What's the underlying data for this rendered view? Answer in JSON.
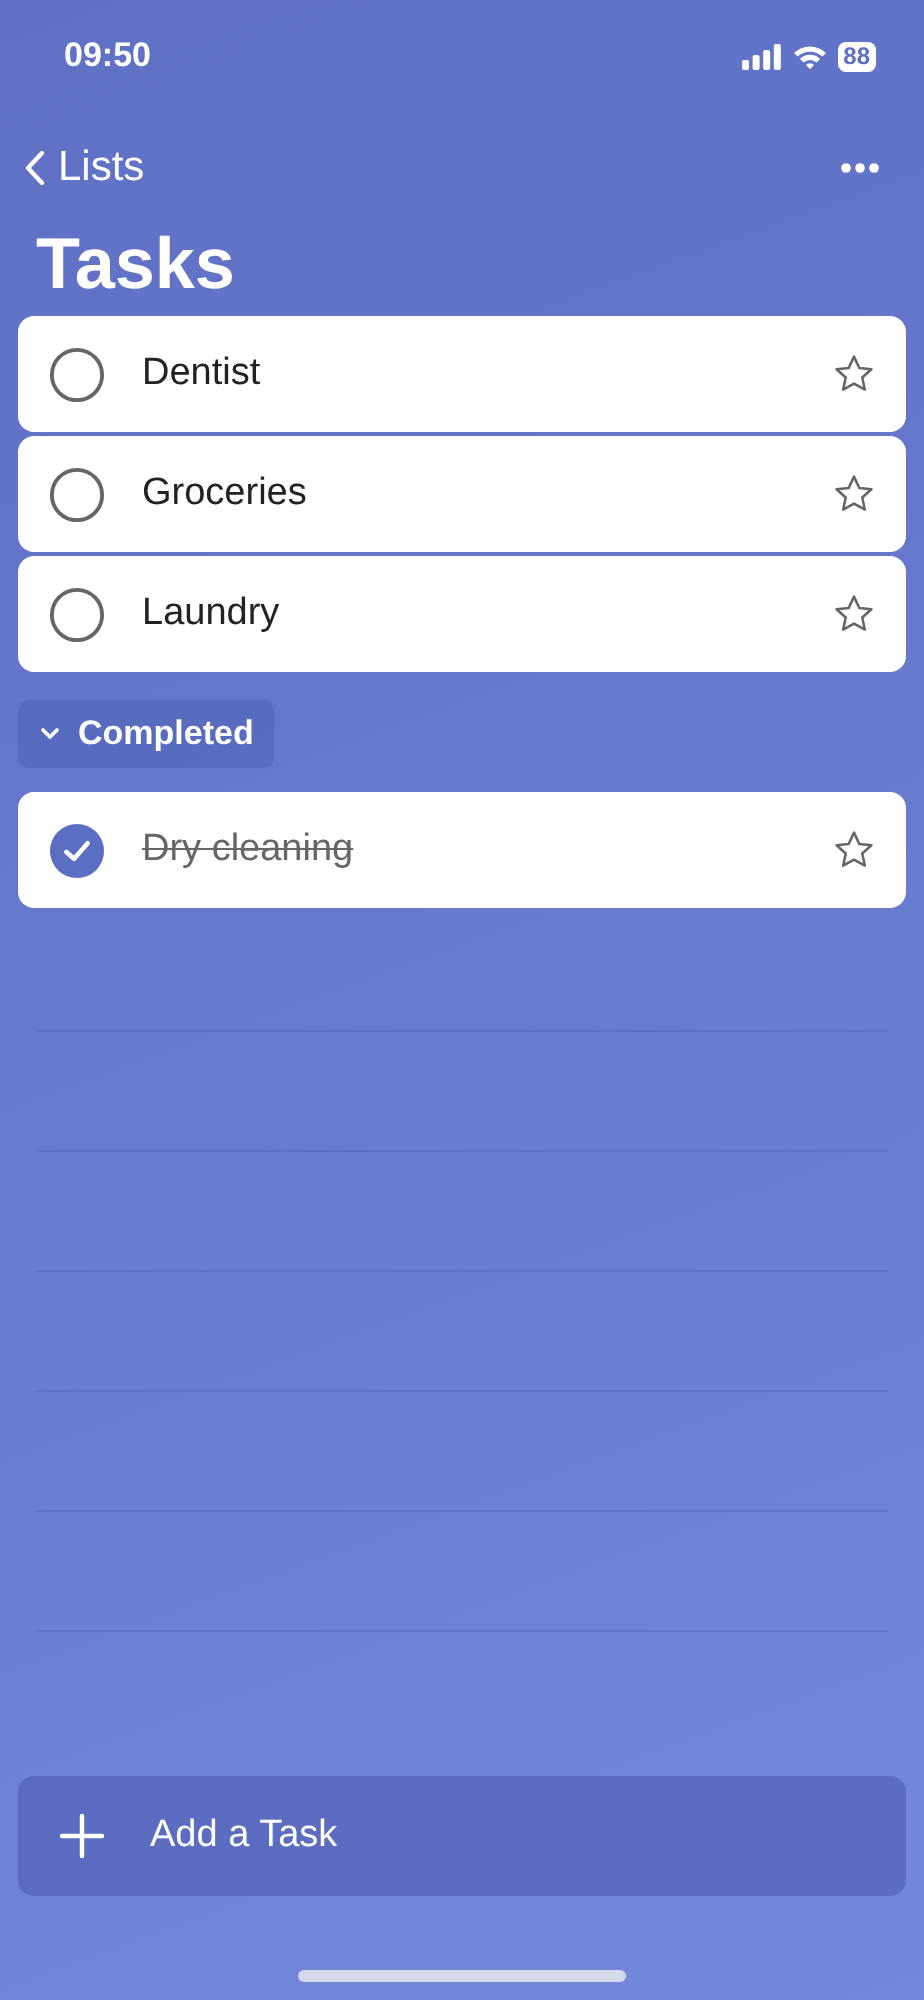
{
  "status_bar": {
    "time": "09:50",
    "battery": "88"
  },
  "nav": {
    "back_label": "Lists"
  },
  "title": "Tasks",
  "tasks": [
    {
      "name": "Dentist",
      "completed": false,
      "starred": false
    },
    {
      "name": "Groceries",
      "completed": false,
      "starred": false
    },
    {
      "name": "Laundry",
      "completed": false,
      "starred": false
    }
  ],
  "completed_section": {
    "label": "Completed",
    "expanded": true,
    "tasks": [
      {
        "name": "Dry cleaning",
        "completed": true,
        "starred": false
      }
    ]
  },
  "add_task": {
    "label": "Add a Task"
  }
}
